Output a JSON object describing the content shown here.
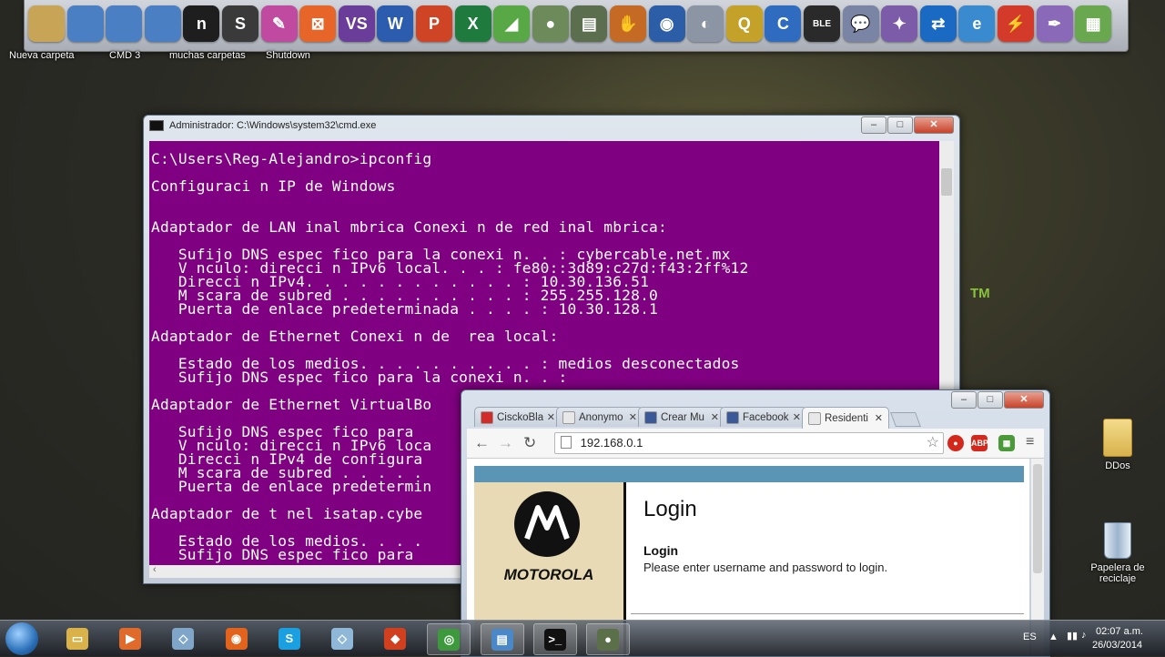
{
  "dock": {
    "icons": [
      {
        "name": "folder-icon",
        "color": "#c8a456",
        "glyph": ""
      },
      {
        "name": "network-globe-icon",
        "color": "#4b7fc4",
        "glyph": ""
      },
      {
        "name": "network-globe-icon-2",
        "color": "#4b7fc4",
        "glyph": ""
      },
      {
        "name": "network-globe-icon-3",
        "color": "#4b7fc4",
        "glyph": ""
      },
      {
        "name": "app-n-icon",
        "color": "#1e1e1e",
        "glyph": "n"
      },
      {
        "name": "sublime-text-icon",
        "color": "#3a3a3a",
        "glyph": "S"
      },
      {
        "name": "paint-palette-icon",
        "color": "#c04aa0",
        "glyph": "✎"
      },
      {
        "name": "xampp-icon",
        "color": "#e8652a",
        "glyph": "⊠"
      },
      {
        "name": "visual-studio-icon",
        "color": "#6a3d9a",
        "glyph": "VS"
      },
      {
        "name": "word-icon",
        "color": "#2b5cae",
        "glyph": "W"
      },
      {
        "name": "powerpoint-icon",
        "color": "#cf4424",
        "glyph": "P"
      },
      {
        "name": "excel-icon",
        "color": "#1f7a3e",
        "glyph": "X"
      },
      {
        "name": "camtasia-icon",
        "color": "#58a845",
        "glyph": "◢"
      },
      {
        "name": "recorder-icon",
        "color": "#6c8a5a",
        "glyph": "●"
      },
      {
        "name": "terminal-shortcut-icon",
        "color": "#5b6e4d",
        "glyph": "▤"
      },
      {
        "name": "glove-icon",
        "color": "#c56a24",
        "glyph": "✋"
      },
      {
        "name": "google-earth-icon",
        "color": "#2c5ea8",
        "glyph": "◉"
      },
      {
        "name": "drive-icon",
        "color": "#8b95a3",
        "glyph": "◐"
      },
      {
        "name": "quicktime-icon",
        "color": "#c4a22a",
        "glyph": "Q"
      },
      {
        "name": "ccleaner-icon",
        "color": "#2f6cc0",
        "glyph": "C"
      },
      {
        "name": "bluestacks-ble-icon",
        "color": "#2a2a2a",
        "glyph": "BLE"
      },
      {
        "name": "chat-bubble-icon",
        "color": "#7a85a6",
        "glyph": "💬"
      },
      {
        "name": "pidgin-icon",
        "color": "#7c5ca8",
        "glyph": "✦"
      },
      {
        "name": "teamviewer-icon",
        "color": "#1a6ac4",
        "glyph": "⇄"
      },
      {
        "name": "internet-explorer-icon",
        "color": "#3a8ad0",
        "glyph": "e"
      },
      {
        "name": "flash-icon",
        "color": "#d33a2a",
        "glyph": "⚡"
      },
      {
        "name": "quill-icon",
        "color": "#8a6ab8",
        "glyph": "✒"
      },
      {
        "name": "bluestacks-icon",
        "color": "#6aa84f",
        "glyph": "▦"
      }
    ],
    "captions": [
      "Nueva carpeta",
      "CMD 3",
      "muchas carpetas",
      "Shutdown"
    ]
  },
  "desktop": {
    "ddos_label": "DDos",
    "bin_label": "Papelera de reciclaje",
    "tm": "TM"
  },
  "cmd": {
    "title": "Administrador: C:\\Windows\\system32\\cmd.exe",
    "lines": [
      "C:\\Users\\Reg-Alejandro>ipconfig",
      "",
      "Configuraci n IP de Windows",
      "",
      "",
      "Adaptador de LAN inal mbrica Conexi n de red inal mbrica:",
      "",
      "   Sufijo DNS espec fico para la conexi n. . : cybercable.net.mx",
      "   V nculo: direcci n IPv6 local. . . : fe80::3d89:c27d:f43:2ff%12",
      "   Direcci n IPv4. . . . . . . . . . . . : 10.30.136.51",
      "   M scara de subred . . . . . . . . . . : 255.255.128.0",
      "   Puerta de enlace predeterminada . . . . : 10.30.128.1",
      "",
      "Adaptador de Ethernet Conexi n de  rea local:",
      "",
      "   Estado de los medios. . . . . . . . . . : medios desconectados",
      "   Sufijo DNS espec fico para la conexi n. . :",
      "",
      "Adaptador de Ethernet VirtualBo",
      "",
      "   Sufijo DNS espec fico para",
      "   V nculo: direcci n IPv6 loca",
      "   Direcci n IPv4 de configura",
      "   M scara de subred . . . . .",
      "   Puerta de enlace predetermin",
      "",
      "Adaptador de t nel isatap.cybe",
      "",
      "   Estado de los medios. . . .",
      "   Sufijo DNS espec fico para"
    ]
  },
  "browser": {
    "tabs": [
      {
        "label": "CisckoBla",
        "color": "#d32a2a"
      },
      {
        "label": "Anonymo",
        "color": "#e8e8e8"
      },
      {
        "label": "Crear Mu",
        "color": "#3b5998"
      },
      {
        "label": "Facebook",
        "color": "#3b5998"
      },
      {
        "label": "Residenti",
        "color": "#e8e8e8"
      }
    ],
    "url": "192.168.0.1",
    "page": {
      "brand": "MOTOROLA",
      "heading": "Login",
      "subheading": "Login",
      "prompt": "Please enter username and password to login."
    }
  },
  "taskbar": {
    "lang": "ES",
    "time": "02:07 a.m.",
    "date": "26/03/2014",
    "items": [
      {
        "name": "file-explorer-icon",
        "color": "#d9b24a",
        "glyph": "▭",
        "active": false
      },
      {
        "name": "media-player-icon",
        "color": "#e06a2a",
        "glyph": "▶",
        "active": false
      },
      {
        "name": "notes-icon",
        "color": "#7fa6c8",
        "glyph": "◇",
        "active": false
      },
      {
        "name": "firefox-icon",
        "color": "#e2631c",
        "glyph": "◉",
        "active": false
      },
      {
        "name": "skype-icon",
        "color": "#1aa0e0",
        "glyph": "S",
        "active": false
      },
      {
        "name": "cards-icon",
        "color": "#8fb8d8",
        "glyph": "◇",
        "active": false
      },
      {
        "name": "git-icon",
        "color": "#d0401e",
        "glyph": "◆",
        "active": false
      },
      {
        "name": "chrome-icon",
        "color": "#3c9a3c",
        "glyph": "◎",
        "active": true
      },
      {
        "name": "control-panel-icon",
        "color": "#4a88c8",
        "glyph": "▤",
        "active": true
      },
      {
        "name": "cmd-icon",
        "color": "#111111",
        "glyph": ">_",
        "active": true
      },
      {
        "name": "recorder-taskbar-icon",
        "color": "#5b7048",
        "glyph": "●",
        "active": true
      }
    ]
  }
}
